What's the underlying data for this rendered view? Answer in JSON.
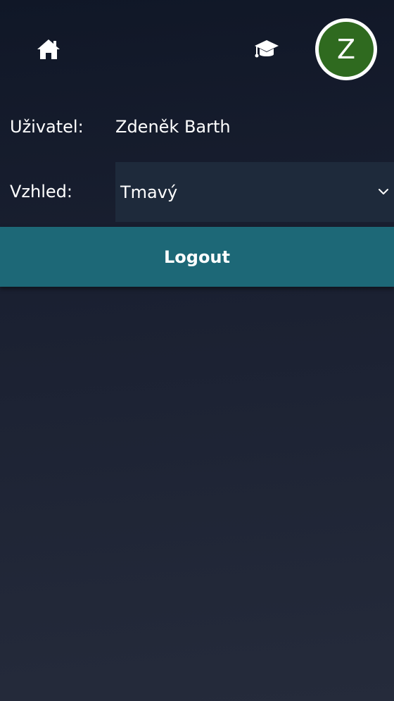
{
  "header": {
    "home_icon": "home-icon",
    "education_icon": "graduation-cap-icon",
    "avatar_initial": "Z",
    "avatar_color": "#2f6a1f"
  },
  "profile": {
    "user_label": "Uživatel:",
    "user_name": "Zdeněk Barth",
    "theme_label": "Vzhled:",
    "theme_value": "Tmavý"
  },
  "actions": {
    "logout_label": "Logout"
  },
  "colors": {
    "accent": "#1d6877",
    "select_bg": "#1e2a3b",
    "background_top": "#101727",
    "background_bottom": "#252b3b"
  }
}
